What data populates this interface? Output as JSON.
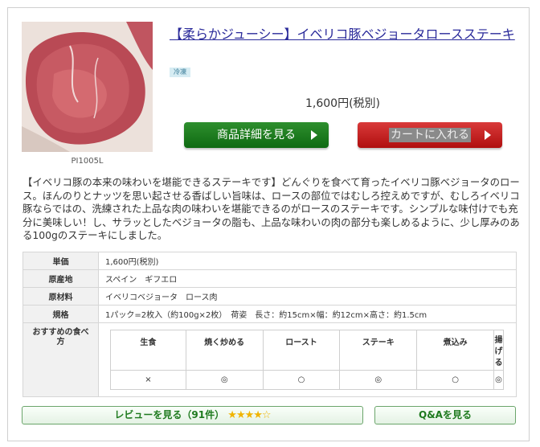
{
  "product": {
    "code": "PI1005L",
    "title": "【柔らかジューシー】イベリコ豚ベジョータロースステーキ",
    "badge": "冷凍",
    "price": "1,600円(税別)"
  },
  "buttons": {
    "detail": "商品詳細を見る",
    "cart": "カートに入れる",
    "review": "レビューを見る（91件）",
    "qa": "Q&Aを見る"
  },
  "review_stars": 4.5,
  "description": "【イベリコ豚の本来の味わいを堪能できるステーキです】どんぐりを食べて育ったイベリコ豚ベジョータのロース。ほんのりとナッツを思い起させる香ばしい旨味は、ロースの部位ではむしろ控えめですが、むしろイベリコ豚ならではの、洗練された上品な肉の味わいを堪能できるのがロースのステーキです。シンプルな味付けでも充分に美味しい！し、サラッとしたベジョータの脂も、上品な味わいの肉の部分も楽しめるように、少し厚みのある100gのステーキにしました。",
  "spec": [
    {
      "label": "単価",
      "value": "1,600円(税別)"
    },
    {
      "label": "原産地",
      "value": "スペイン　ギフエロ"
    },
    {
      "label": "原材料",
      "value": "イベリコベジョータ　ロース肉"
    },
    {
      "label": "規格",
      "value": "1パック=2枚入（約100g×2枚）　荷姿　長さ：約15cm×幅：約12cm×高さ：約1.5cm"
    }
  ],
  "cooking": {
    "label": "おすすめの食べ方",
    "methods": [
      "生食",
      "焼く炒める",
      "ロースト",
      "ステーキ",
      "煮込み",
      "揚げる"
    ],
    "ratings": [
      "×",
      "◎",
      "○",
      "◎",
      "○",
      "◎"
    ]
  },
  "colors": {
    "title_link": "#2a2a9a",
    "detail_button": "#1a7a1a",
    "cart_button": "#c41e1e",
    "star": "#f0b400"
  }
}
